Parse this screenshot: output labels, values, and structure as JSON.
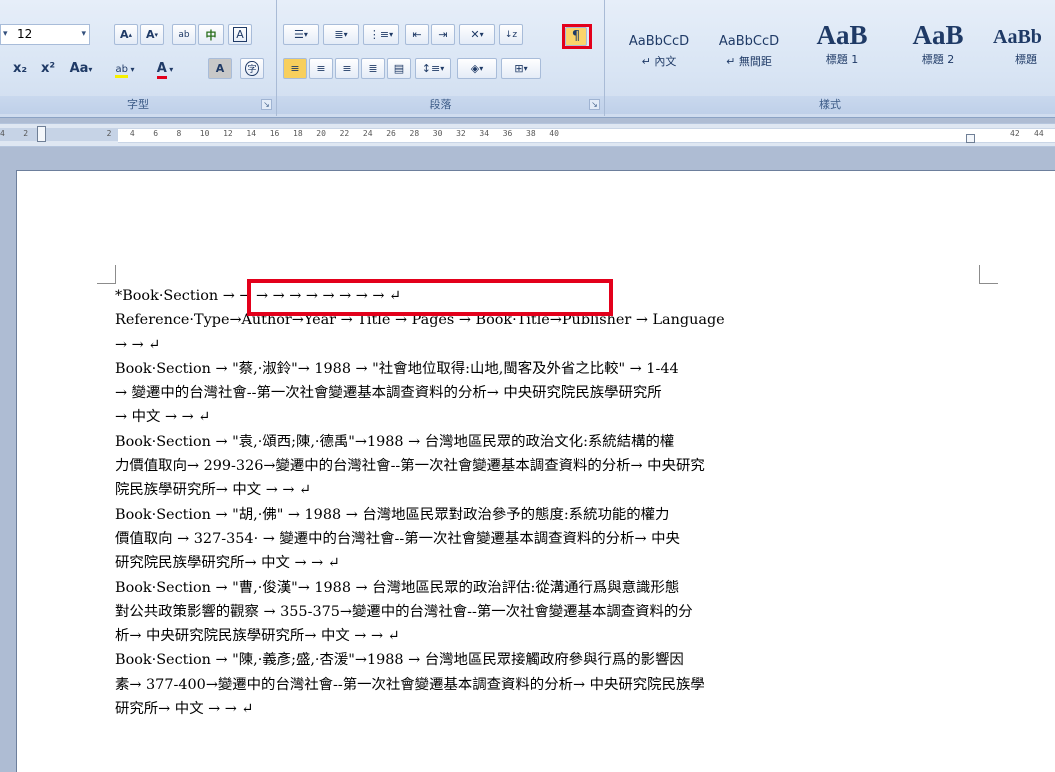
{
  "ribbon": {
    "font_group": {
      "label": "字型",
      "font_size": "12",
      "grow_label": "A",
      "shrink_label": "A",
      "phonetic_label": "ab",
      "asian_layout_label": "中",
      "char_border_label": "A",
      "subscript_label": "x₂",
      "superscript_label": "x²",
      "change_case_label": "Aa",
      "highlight_label": "ab",
      "font_color_label": "A",
      "char_shading_label": "A",
      "enclose_label": "字"
    },
    "paragraph_group": {
      "label": "段落"
    },
    "styles_group": {
      "label": "樣式",
      "tiles": [
        {
          "sample": "AaBbCcD",
          "name": "↵ 內文"
        },
        {
          "sample": "AaBbCcD",
          "name": "↵ 無間距"
        },
        {
          "sample": "AaB",
          "name": "標題 1"
        },
        {
          "sample": "AaB",
          "name": "標題 2"
        },
        {
          "sample": "AaBb",
          "name": "標題"
        }
      ]
    }
  },
  "ruler": {
    "numbers": [
      "4",
      "2",
      "2",
      "4",
      "6",
      "8",
      "10",
      "12",
      "14",
      "16",
      "18",
      "20",
      "22",
      "24",
      "26",
      "28",
      "30",
      "32",
      "34",
      "36",
      "38",
      "40",
      "42",
      "44"
    ]
  },
  "document": {
    "lines": [
      "*Book·Section → → → → → → → → → → ↵",
      "Reference·Type→Author→Year → Title → Pages → Book·Title→Publisher → Language",
      " → → ↵",
      "Book·Section → \"蔡,·淑鈴\"→ 1988 → \"社會地位取得:山地,閩客及外省之比較\" → 1-44",
      " → 變遷中的台灣社會--第一次社會變遷基本調查資料的分析→ 中央研究院民族學研究所",
      " → 中文 → → ↵",
      "Book·Section → \"袁,·頌西;陳,·德禹\"→1988 → 台灣地區民眾的政治文化:系統結構的權",
      "力價值取向→ 299-326→變遷中的台灣社會--第一次社會變遷基本調查資料的分析→ 中央研究",
      "院民族學研究所→ 中文 → → ↵",
      "Book·Section → \"胡,·佛\" → 1988 → 台灣地區民眾對政治參予的態度:系統功能的權力",
      "價值取向 → 327-354· → 變遷中的台灣社會--第一次社會變遷基本調查資料的分析→ 中央",
      "研究院民族學研究所→ 中文 → → ↵",
      "Book·Section → \"曹,·俊漢\"→ 1988 → 台灣地區民眾的政治評估:從溝通行爲與意識形態",
      "對公共政策影響的觀察 → 355-375→變遷中的台灣社會--第一次社會變遷基本調查資料的分",
      "析→ 中央研究院民族學研究所→ 中文 → → ↵",
      "Book·Section → \"陳,·義彥;盛,·杏湲\"→1988 → 台灣地區民眾接觸政府參與行爲的影響因",
      "素→ 377-400→變遷中的台灣社會--第一次社會變遷基本調查資料的分析→ 中央研究院民族學",
      "研究所→ 中文 → → ↵"
    ]
  }
}
